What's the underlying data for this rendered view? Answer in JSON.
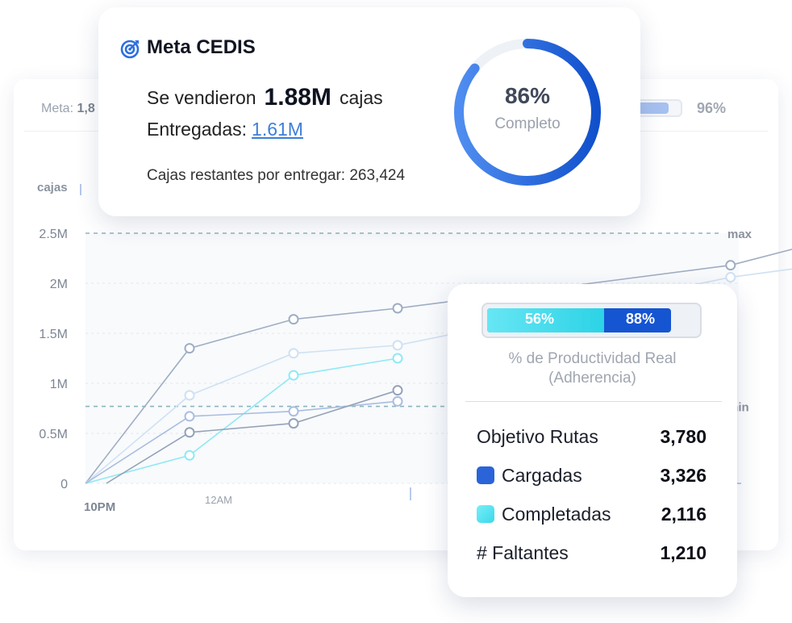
{
  "background_card": {
    "meta_label": "Meta:",
    "meta_value": "1,8",
    "progress_fraction": 0.72,
    "progress_color": "#a6c0f0",
    "percent": "96%",
    "unit_label": "cajas"
  },
  "chart_data": {
    "type": "line",
    "ylim": [
      0,
      2500000
    ],
    "y_ticks": [
      "0",
      "0.5M",
      "1M",
      "1.5M",
      "2M",
      "2.5M"
    ],
    "x_labels": [
      "10PM",
      "12AM"
    ],
    "reference_lines": [
      {
        "label": "max",
        "value": 2500000
      },
      {
        "label": "min",
        "value": 770000
      }
    ],
    "series": [
      {
        "color": "#9fadc2",
        "x": [
          0,
          1,
          2,
          3,
          6.2,
          7.2
        ],
        "values": [
          0,
          1350000,
          1640000,
          1750000,
          2180000,
          2450000
        ]
      },
      {
        "color": "#cfe1f3",
        "x": [
          0,
          1,
          2,
          3,
          6.2,
          7.2
        ],
        "values": [
          0,
          880000,
          1300000,
          1380000,
          2060000,
          2200000
        ]
      },
      {
        "color": "#8fe9f3",
        "x": [
          0,
          1,
          2,
          3
        ],
        "values": [
          0,
          280000,
          1080000,
          1250000
        ]
      },
      {
        "color": "#aabde0",
        "x": [
          0,
          1,
          2,
          3
        ],
        "values": [
          0,
          670000,
          720000,
          820000
        ]
      },
      {
        "color": "#94a2b6",
        "x": [
          0.2,
          1,
          2,
          3
        ],
        "values": [
          0,
          510000,
          600000,
          930000
        ]
      }
    ]
  },
  "meta_card": {
    "icon": "target-icon",
    "title": "Meta CEDIS",
    "sold_prefix": "Se vendieron",
    "sold_value": "1.88M",
    "sold_suffix": "cajas",
    "delivered_label": "Entregadas:",
    "delivered_value": "1.61M",
    "remaining_text": "Cajas restantes por entregar: 263,424",
    "ring_percent": "86%",
    "ring_fraction": 0.86,
    "ring_label": "Completo",
    "ring_color_start": "#4f8df0",
    "ring_color_end": "#1150cc",
    "ring_track_color": "#eef1f6"
  },
  "productivity_card": {
    "real_percent": "56%",
    "real_fraction": 0.56,
    "total_percent": "88%",
    "total_fraction": 0.88,
    "caption_line1": "% de Productividad Real",
    "caption_line2": "(Adherencia)",
    "rows": [
      {
        "label": "Objetivo Rutas",
        "value": "3,780",
        "swatch": ""
      },
      {
        "label": "Cargadas",
        "value": "3,326",
        "swatch": "#2a64d8"
      },
      {
        "label": "Completadas",
        "value": "2,116",
        "swatch": "#3ad8ea"
      },
      {
        "label": "# Faltantes",
        "value": "1,210",
        "swatch": ""
      }
    ]
  }
}
